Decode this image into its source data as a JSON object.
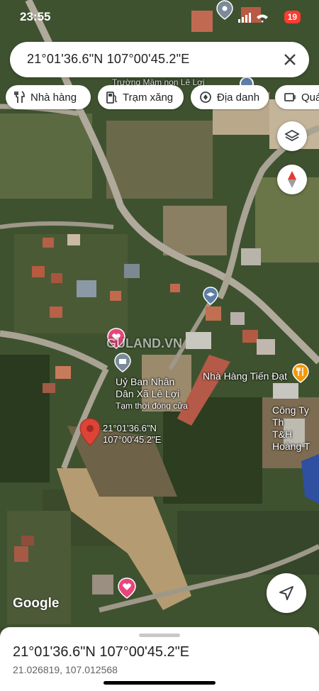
{
  "status_bar": {
    "time": "23:55",
    "battery": "19"
  },
  "search": {
    "query": "21°01'36.6\"N 107°00'45.2\"E"
  },
  "chips": [
    {
      "label": "Nhà hàng",
      "icon": "fork-knife-icon"
    },
    {
      "label": "Trạm xăng",
      "icon": "gas-station-icon"
    },
    {
      "label": "Địa danh",
      "icon": "landmark-icon"
    },
    {
      "label": "Quá",
      "icon": "shop-icon"
    }
  ],
  "map_labels": {
    "school_top": "Trường Mầm non Lê Lợi",
    "watermark": "GULAND.VN",
    "committee_line1": "Uỷ Ban Nhân",
    "committee_line2": "Dân Xã Lê Lợi",
    "committee_status": "Tạm thời đóng cửa",
    "restaurant": "Nhà Hàng Tiến Đạt",
    "company_line1": "Công Ty Th",
    "company_line2": "T&H Hoàng T",
    "pin_line1": "21°01'36.6\"N",
    "pin_line2": "107°00'45.2\"E"
  },
  "google_logo": "Google",
  "bottom_sheet": {
    "title": "21°01'36.6\"N 107°00'45.2\"E",
    "subtitle": "21.026819, 107.012568"
  },
  "colors": {
    "pin_red": "#db4437",
    "poi_pink": "#e8457a",
    "poi_school": "#5c7fa6",
    "poi_food": "#f29900"
  }
}
